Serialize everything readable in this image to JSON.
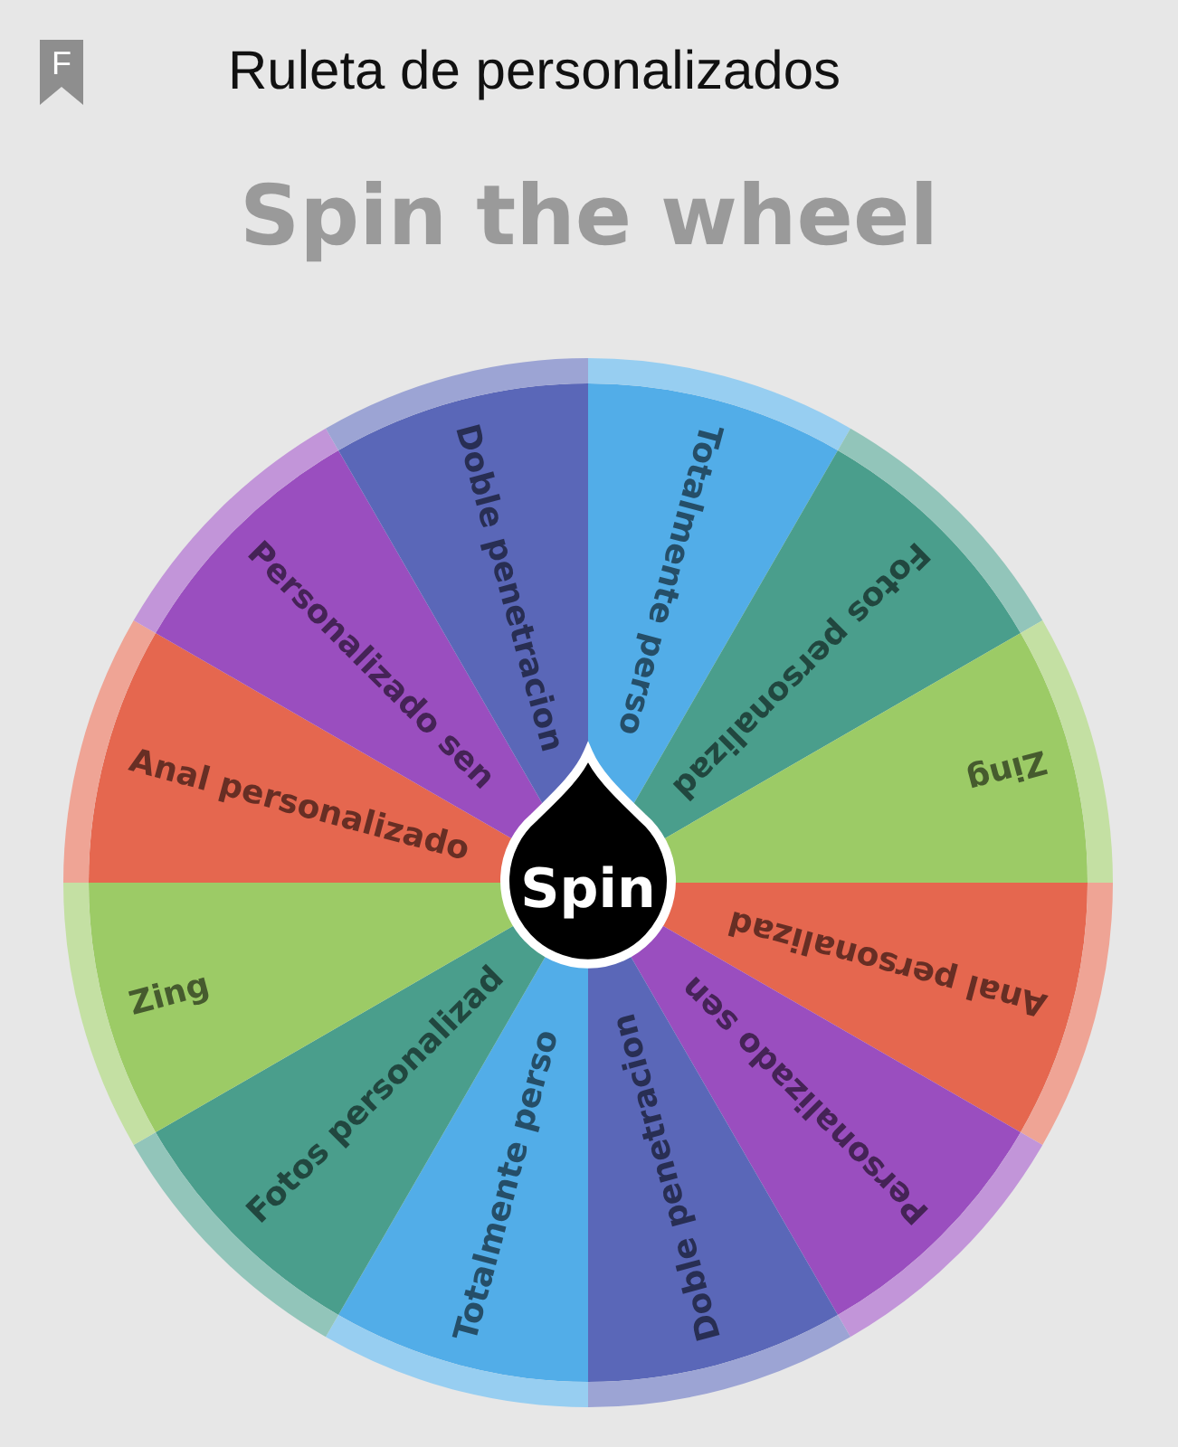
{
  "header": {
    "badge_letter": "F",
    "title": "Ruleta de personalizados"
  },
  "heading": "Spin the wheel",
  "wheel": {
    "button": "Spin",
    "segments": [
      {
        "label": "Totalmente perso",
        "color": "#52ade8"
      },
      {
        "label": "Fotos personalizad",
        "color": "#4a9e8c"
      },
      {
        "label": "Zing",
        "color": "#9ccb66"
      },
      {
        "label": "Anal personalizad",
        "color": "#e5674f"
      },
      {
        "label": "Personalizado sen",
        "color": "#9a4ebf"
      },
      {
        "label": "Doble penetracion",
        "color": "#5a67b8"
      },
      {
        "label": "Totalmente perso",
        "color": "#52ade8"
      },
      {
        "label": "Fotos personalizad",
        "color": "#4a9e8c"
      },
      {
        "label": "Zing",
        "color": "#9ccb66"
      },
      {
        "label": "Anal personalizado",
        "color": "#e5674f"
      },
      {
        "label": "Personalizado sen",
        "color": "#9a4ebf"
      },
      {
        "label": "Doble penetracion",
        "color": "#5a67b8"
      }
    ]
  }
}
